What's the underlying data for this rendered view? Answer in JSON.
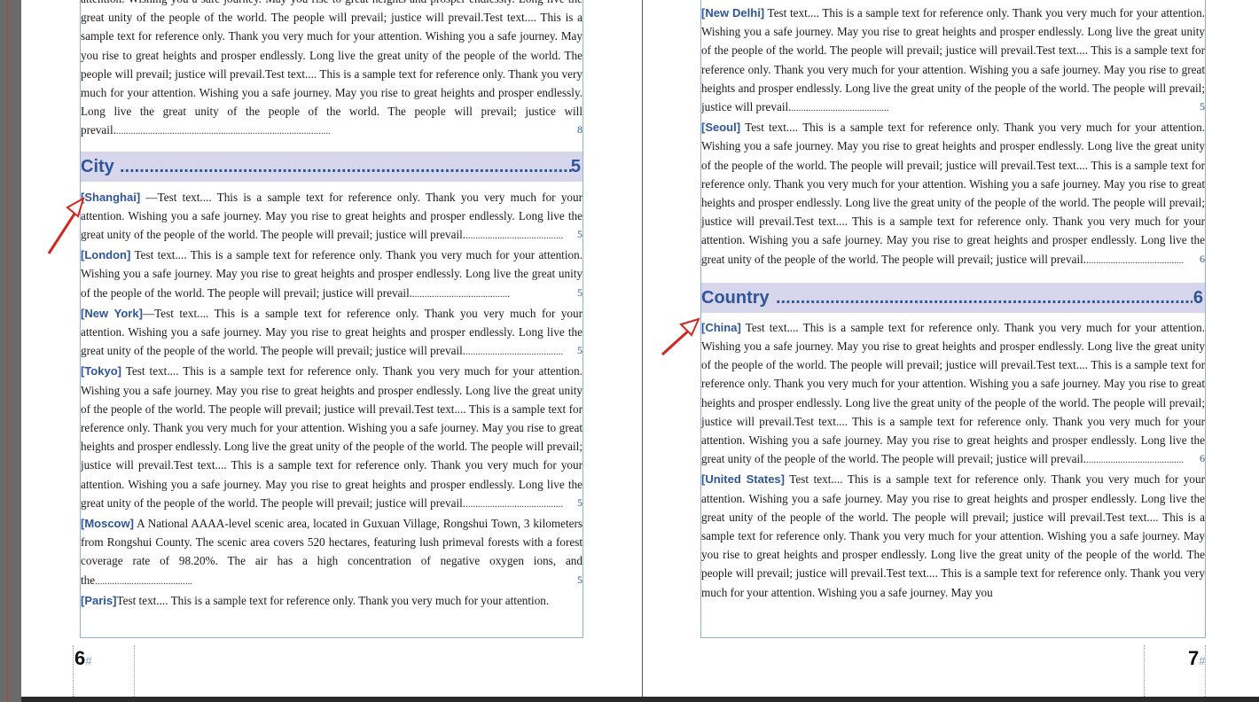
{
  "pages": {
    "left_number": "6",
    "right_number": "7",
    "number_mark": "#"
  },
  "left": {
    "intro_lines": "attention. Wishing you a safe journey. May you rise to great heights and prosper endlessly. Long live the great unity of the people of the world. The people will prevail; justice will prevail.Test text.... This is a sample text for reference only. Thank you very much for your attention. Wishing you a safe journey. May you rise to great heights and prosper endlessly. Long live the great unity of the people of the world. The people will prevail; justice will prevail.Test text.... This is a sample text for reference only. Thank you very much for your attention. Wishing you a safe journey. May you rise to great heights and prosper endlessly. Long live the great unity of the people of the world. The people will prevail; justice will prevail.",
    "intro_page": "8",
    "heading": "City",
    "heading_page": "5",
    "entries": [
      {
        "name": "[Shanghai]",
        "text": " —Test text.... This is a sample text for reference only. Thank you very much for your attention. Wishing you a safe journey. May you rise to great heights and prosper endlessly. Long live the great unity of the people of the world. The people will prevail; justice will prevail.",
        "page": "5"
      },
      {
        "name": "[London]",
        "text": " Test text.... This is a sample text for reference only. Thank you very much for your attention. Wishing you a safe journey. May you rise to great heights and prosper endlessly. Long live the great unity of the people of the world. The people will prevail; justice will prevail.",
        "page": "5"
      },
      {
        "name": "[New York]",
        "text": "—Test text.... This is a sample text for reference only. Thank you very much for your attention. Wishing you a safe journey. May you rise to great heights and prosper endlessly. Long live the great unity of the people of the world. The people will prevail; justice will prevail.",
        "page": "5"
      },
      {
        "name": "[Tokyo]",
        "text": " Test text.... This is a sample text for reference only. Thank you very much for your attention. Wishing you a safe journey. May you rise to great heights and prosper endlessly. Long live the great unity of the people of the world. The people will prevail; justice will prevail.Test text.... This is a sample text for reference only. Thank you very much for your attention. Wishing you a safe journey. May you rise to great heights and prosper endlessly. Long live the great unity of the people of the world. The people will prevail; justice will prevail.Test text.... This is a sample text for reference only. Thank you very much for your attention. Wishing you a safe journey. May you rise to great heights and prosper endlessly. Long live the great unity of the people of the world. The people will prevail; justice will prevail.",
        "page": "5"
      },
      {
        "name": "[Moscow]",
        "text": " A National AAAA-level scenic area, located in Guxuan Village, Rongshui Town, 3 kilometers from Rongshui County. The scenic area covers 520 hectares, featuring lush primeval forests with a forest coverage rate of 98.20%. The air has a high concentration of negative oxygen ions, and the",
        "page": "5"
      },
      {
        "name": "[Paris]",
        "text": "Test text.... This is a sample text for reference only. Thank you very much for your attention.",
        "page": ""
      }
    ]
  },
  "right": {
    "entries_top": [
      {
        "name": "[New Delhi]",
        "text": " Test text.... This is a sample text for reference only. Thank you very much for your attention. Wishing you a safe journey. May you rise to great heights and prosper endlessly. Long live the great unity of the people of the world. The people will prevail; justice will prevail.Test text.... This is a sample text for reference only. Thank you very much for your attention. Wishing you a safe journey. May you rise to great heights and prosper endlessly. Long live the great unity of the people of the world. The people will prevail; justice will prevail.",
        "page": "5"
      },
      {
        "name": "[Seoul]",
        "text": " Test text.... This is a sample text for reference only. Thank you very much for your attention. Wishing you a safe journey. May you rise to great heights and prosper endlessly. Long live the great unity of the people of the world. The people will prevail; justice will prevail.Test text.... This is a sample text for reference only. Thank you very much for your attention. Wishing you a safe journey. May you rise to great heights and prosper endlessly. Long live the great unity of the people of the world. The people will prevail; justice will prevail.Test text.... This is a sample text for reference only. Thank you very much for your attention. Wishing you a safe journey. May you rise to great heights and prosper endlessly. Long live the great unity of the people of the world. The people will prevail; justice will prevail.",
        "page": "6"
      }
    ],
    "heading": "Country",
    "heading_page": "6",
    "entries_bottom": [
      {
        "name": "[China]",
        "text": " Test text.... This is a sample text for reference only. Thank you very much for your attention. Wishing you a safe journey. May you rise to great heights and prosper endlessly. Long live the great unity of the people of the world. The people will prevail; justice will prevail.Test text.... This is a sample text for reference only. Thank you very much for your attention. Wishing you a safe journey. May you rise to great heights and prosper endlessly. Long live the great unity of the people of the world. The people will prevail; justice will prevail.Test text.... This is a sample text for reference only. Thank you very much for your attention. Wishing you a safe journey. May you rise to great heights and prosper endlessly. Long live the great unity of the people of the world. The people will prevail; justice will prevail.",
        "page": "6"
      },
      {
        "name": "[United States]",
        "text": " Test text.... This is a sample text for reference only. Thank you very much for your attention. Wishing you a safe journey. May you rise to great heights and prosper endlessly. Long live the great unity of the people of the world. The people will prevail; justice will prevail.Test text.... This is a sample text for reference only. Thank you very much for your attention. Wishing you a safe journey. May you rise to great heights and prosper endlessly. Long live the great unity of the people of the world. The people will prevail; justice will prevail.Test text.... This is a sample text for reference only. Thank you very much for your attention. Wishing you a safe journey. May you",
        "page": ""
      }
    ]
  },
  "colors": {
    "accent": "#2e5597",
    "heading_band": "#d8d6ec",
    "arrow": "#d0281e"
  }
}
